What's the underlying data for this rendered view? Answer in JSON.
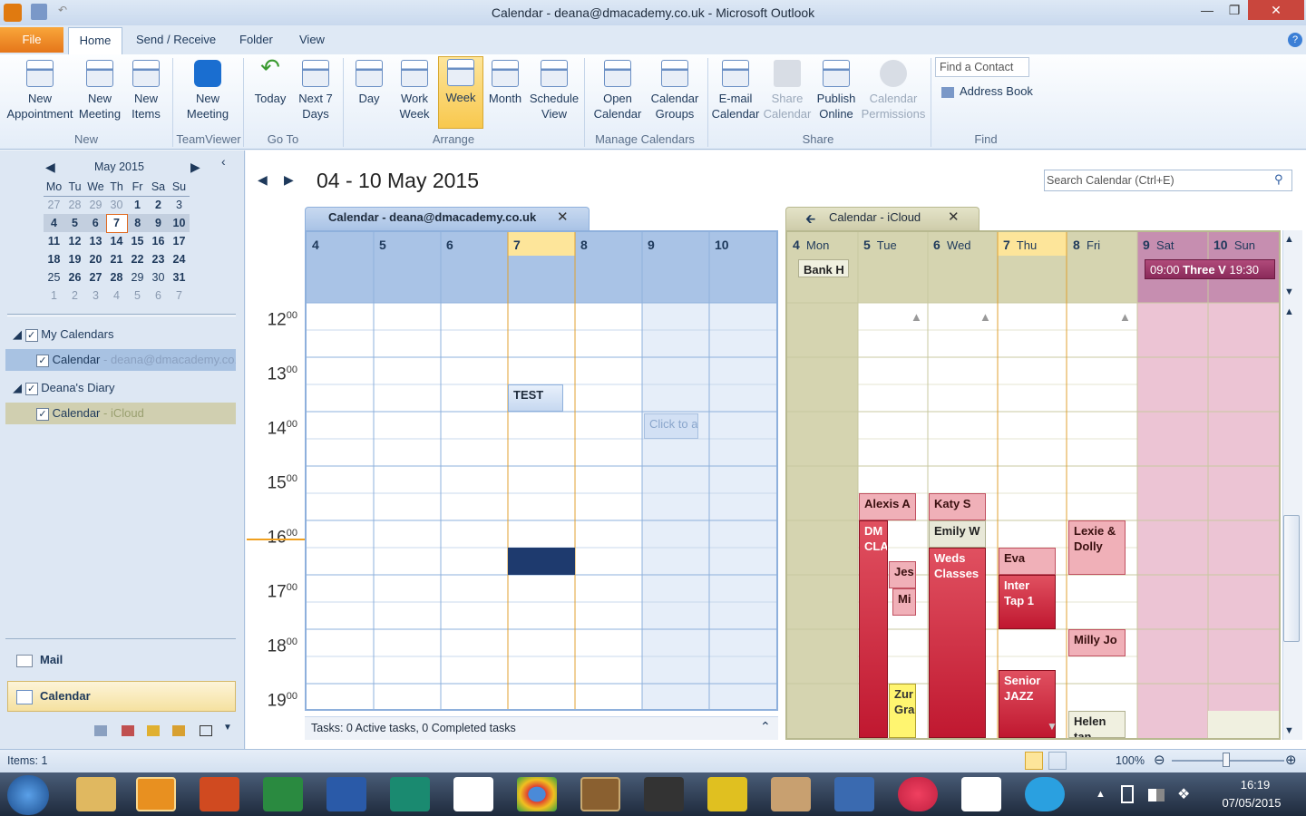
{
  "window": {
    "title": "Calendar - deana@dmacademy.co.uk - Microsoft Outlook"
  },
  "tabs": [
    "File",
    "Home",
    "Send / Receive",
    "Folder",
    "View"
  ],
  "ribbon": {
    "new_appointment": "New Appointment",
    "new_meeting": "New Meeting",
    "new_items": "New Items",
    "tv_meeting": "New Meeting",
    "today": "Today",
    "next7": "Next 7 Days",
    "day": "Day",
    "work_week": "Work Week",
    "week": "Week",
    "month": "Month",
    "schedule_view": "Schedule View",
    "open_calendar": "Open Calendar",
    "calendar_groups": "Calendar Groups",
    "email_calendar": "E-mail Calendar",
    "share_calendar": "Share Calendar",
    "publish_online": "Publish Online",
    "calendar_permissions": "Calendar Permissions",
    "find_contact": "Find a Contact",
    "address_book": "Address Book",
    "groups": {
      "new": "New",
      "teamviewer": "TeamViewer",
      "goto": "Go To",
      "arrange": "Arrange",
      "manage": "Manage Calendars",
      "share": "Share",
      "find": "Find"
    }
  },
  "mini_cal": {
    "month": "May 2015",
    "days": [
      "Mo",
      "Tu",
      "We",
      "Th",
      "Fr",
      "Sa",
      "Su"
    ],
    "weeks": [
      [
        "27",
        "28",
        "29",
        "30",
        "1",
        "2",
        "3"
      ],
      [
        "4",
        "5",
        "6",
        "7",
        "8",
        "9",
        "10"
      ],
      [
        "11",
        "12",
        "13",
        "14",
        "15",
        "16",
        "17"
      ],
      [
        "18",
        "19",
        "20",
        "21",
        "22",
        "23",
        "24"
      ],
      [
        "25",
        "26",
        "27",
        "28",
        "29",
        "30",
        "31"
      ],
      [
        "1",
        "2",
        "3",
        "4",
        "5",
        "6",
        "7"
      ]
    ]
  },
  "nav": {
    "my_calendars": "My Calendars",
    "calendar": "Calendar",
    "calendar_sub": "- deana@dmacademy.co.uk",
    "deanas_diary": "Deana's Diary",
    "calendar2": "Calendar",
    "calendar2_sub": "- iCloud",
    "mail": "Mail",
    "calendar_nav": "Calendar"
  },
  "main": {
    "date_range": "04 - 10 May 2015",
    "search_placeholder": "Search Calendar (Ctrl+E)",
    "left_tab": "Calendar - deana@dmacademy.co.uk",
    "right_tab": "Calendar - iCloud",
    "left_days": [
      "4",
      "5",
      "6",
      "7",
      "8",
      "9",
      "10"
    ],
    "right_days": [
      [
        "4",
        "Mon"
      ],
      [
        "5",
        "Tue"
      ],
      [
        "6",
        "Wed"
      ],
      [
        "7",
        "Thu"
      ],
      [
        "8",
        "Fri"
      ],
      [
        "9",
        "Sat"
      ],
      [
        "10",
        "Sun"
      ]
    ],
    "hours": [
      "12",
      "13",
      "14",
      "15",
      "16",
      "17",
      "18",
      "19"
    ],
    "minutes": "00",
    "tasks": "Tasks: 0 Active tasks, 0 Completed tasks",
    "events": {
      "test": "TEST",
      "click": "Click to a",
      "bank": "Bank H",
      "three_start": "09:00",
      "three_title": "Three V",
      "three_end": "19:30",
      "alexis": "Alexis A",
      "katy": "Katy S",
      "emily": "Emily W",
      "dm": "DM CLA",
      "jes": "Jes",
      "mi": "Mi",
      "weds": "Weds Classes",
      "eva": "Eva",
      "inter": "Inter Tap 1",
      "lexie": "Lexie & Dolly",
      "milly": "Milly Jo",
      "senior": "Senior JAZZ",
      "zur": "Zur Gra",
      "helen": "Helen tan"
    }
  },
  "status": {
    "items": "Items: 1",
    "zoom": "100%"
  },
  "clock": {
    "time": "16:19",
    "date": "07/05/2015"
  }
}
